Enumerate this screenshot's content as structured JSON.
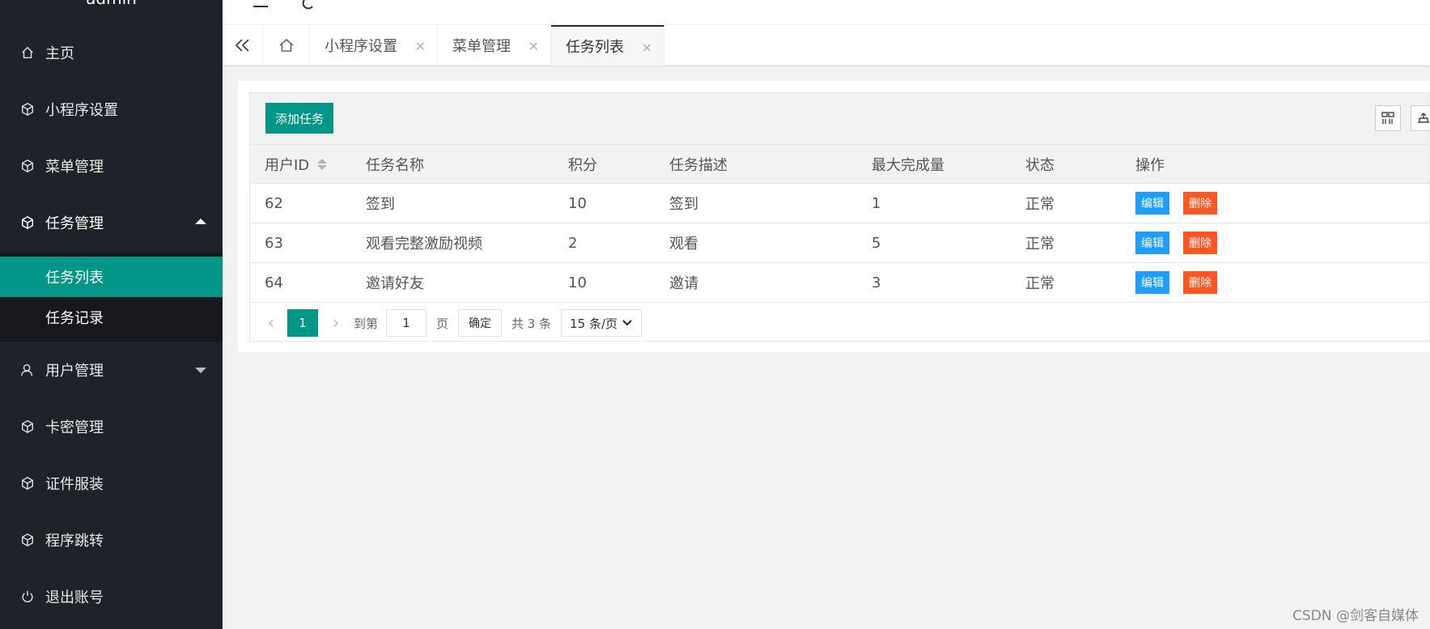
{
  "sidebar": {
    "user": "admin",
    "items": [
      {
        "label": "主页",
        "icon": "home-icon"
      },
      {
        "label": "小程序设置",
        "icon": "cube-icon"
      },
      {
        "label": "菜单管理",
        "icon": "cube-icon"
      },
      {
        "label": "任务管理",
        "icon": "cube-icon"
      },
      {
        "label": "用户管理",
        "icon": "user-icon"
      },
      {
        "label": "卡密管理",
        "icon": "cube-icon"
      },
      {
        "label": "证件服装",
        "icon": "cube-icon"
      },
      {
        "label": "程序跳转",
        "icon": "cube-icon"
      },
      {
        "label": "退出账号",
        "icon": "power-icon"
      }
    ],
    "subitems": [
      {
        "label": "任务列表"
      },
      {
        "label": "任务记录"
      }
    ]
  },
  "tabs": [
    {
      "label": "小程序设置"
    },
    {
      "label": "菜单管理"
    },
    {
      "label": "任务列表"
    }
  ],
  "tab_close": "×",
  "toolbar": {
    "add_label": "添加任务"
  },
  "table": {
    "headers": [
      "用户ID",
      "任务名称",
      "积分",
      "任务描述",
      "最大完成量",
      "状态",
      "操作"
    ],
    "rows": [
      {
        "id": "62",
        "name": "签到",
        "points": "10",
        "desc": "签到",
        "max": "1",
        "status": "正常"
      },
      {
        "id": "63",
        "name": "观看完整激励视频",
        "points": "2",
        "desc": "观看",
        "max": "5",
        "status": "正常"
      },
      {
        "id": "64",
        "name": "邀请好友",
        "points": "10",
        "desc": "邀请",
        "max": "3",
        "status": "正常"
      }
    ],
    "edit_label": "编辑",
    "delete_label": "删除"
  },
  "pager": {
    "current": "1",
    "goto_label": "到第",
    "page_input": "1",
    "page_suffix": "页",
    "ok_label": "确定",
    "total": "共 3 条",
    "per_page": "15 条/页"
  },
  "watermark": "CSDN @剑客自媒体",
  "colors": {
    "accent": "#009688",
    "sidebar": "#20222a",
    "edit": "#1e9fff",
    "delete": "#ff5722"
  }
}
